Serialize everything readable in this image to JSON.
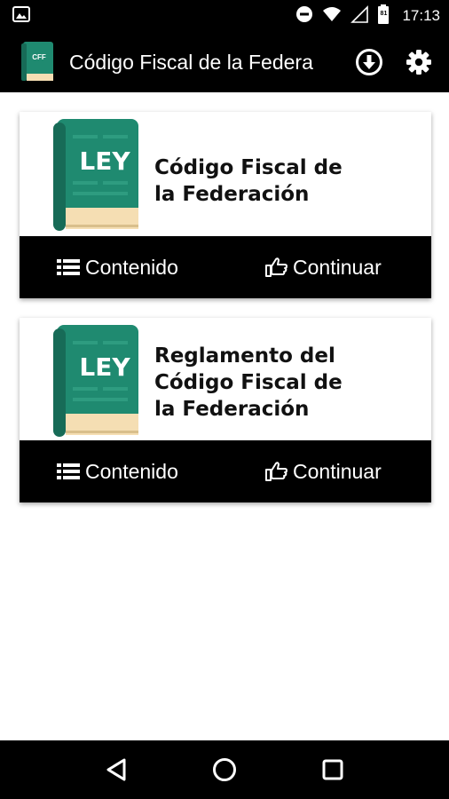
{
  "status_bar": {
    "time": "17:13",
    "battery_level": "81",
    "icons": [
      "image-icon",
      "do-not-disturb-icon",
      "wifi-icon",
      "cell-signal-icon",
      "battery-icon"
    ]
  },
  "app_bar": {
    "logo_text": "CFF",
    "title": "Código Fiscal de la Federa",
    "icons": [
      "download-icon",
      "settings-icon"
    ]
  },
  "books": [
    {
      "cover_label": "LEY",
      "title_lines": [
        "Código Fiscal de",
        "la Federación"
      ],
      "contenido_label": "Contenido",
      "continuar_label": "Continuar"
    },
    {
      "cover_label": "LEY",
      "title_lines": [
        "Reglamento del",
        "Código Fiscal de",
        "la Federación"
      ],
      "contenido_label": "Contenido",
      "continuar_label": "Continuar"
    }
  ],
  "colors": {
    "bar_bg": "#000000",
    "book_green": "#1f8a70",
    "book_pages": "#f5deb3",
    "card_text": "#111111"
  },
  "nav_bar": {
    "icons": [
      "back-icon",
      "home-icon",
      "recents-icon"
    ]
  }
}
